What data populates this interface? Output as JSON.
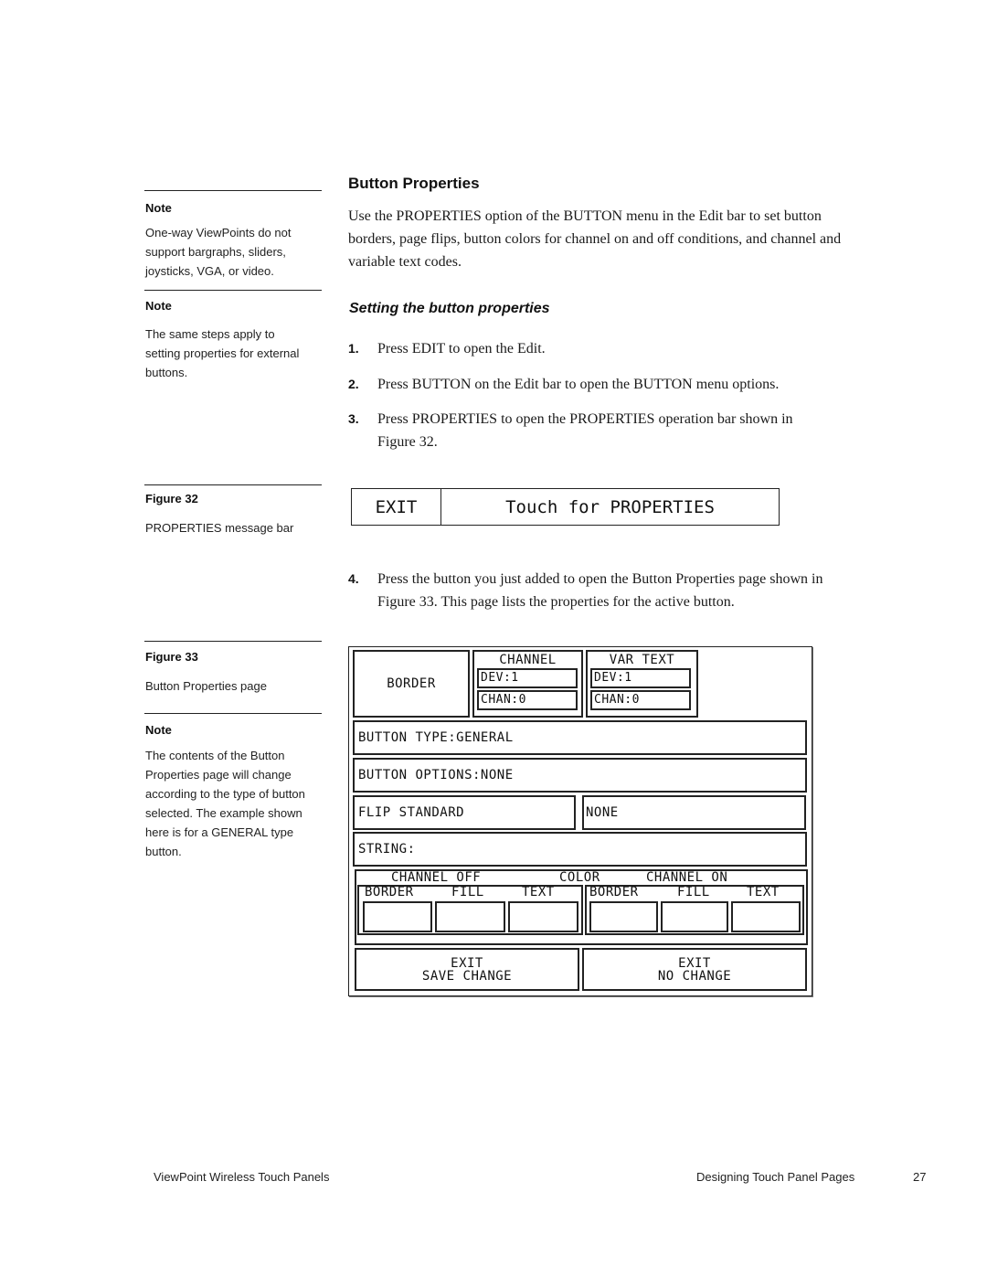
{
  "sidebar": {
    "note1": {
      "heading": "Note",
      "lines": [
        "One-way ViewPoints do not",
        "support bargraphs, sliders,",
        "joysticks, VGA, or video."
      ]
    },
    "note2": {
      "heading": "Note",
      "lines": [
        "The same steps apply to",
        "setting properties for external",
        "buttons."
      ]
    },
    "figure32": {
      "heading": "Figure 32",
      "caption": "PROPERTIES message bar"
    },
    "figure33": {
      "heading": "Figure 33",
      "caption": "Button Properties page"
    },
    "note3": {
      "heading": "Note",
      "lines": [
        "The contents of the Button",
        "Properties page will change",
        "according to the type of button",
        "selected. The example shown",
        "here is for a GENERAL type",
        "button."
      ]
    }
  },
  "main": {
    "section_title": "Button Properties",
    "intro_lines": [
      "Use the PROPERTIES option of the BUTTON menu in the Edit bar to set button",
      "borders, page flips, button colors for channel on and off conditions, and channel and",
      "variable text codes."
    ],
    "subsection_title": "Setting the button properties",
    "steps": [
      {
        "num": "1.",
        "lines": [
          "Press EDIT to open the Edit."
        ]
      },
      {
        "num": "2.",
        "lines": [
          "Press BUTTON on the Edit bar to open the BUTTON menu options."
        ]
      },
      {
        "num": "3.",
        "lines": [
          "Press PROPERTIES to open the PROPERTIES operation bar shown in",
          "Figure 32."
        ]
      },
      {
        "num": "4.",
        "lines": [
          "Press the button you just added to open the Button Properties page shown in",
          "Figure 33. This page lists the properties for the active button."
        ]
      }
    ]
  },
  "figure32_bar": {
    "exit_label": "EXIT",
    "message": "Touch for PROPERTIES"
  },
  "figure33_panel": {
    "border_button": "BORDER",
    "channel": {
      "title": "CHANNEL",
      "dev": "DEV:1",
      "chan": "CHAN:0"
    },
    "var_text": {
      "title": "VAR TEXT",
      "dev": "DEV:1",
      "chan": "CHAN:0"
    },
    "button_type": "BUTTON TYPE:GENERAL",
    "button_options": "BUTTON OPTIONS:NONE",
    "flip": "FLIP STANDARD",
    "flip_target": "NONE",
    "string": "STRING:",
    "color": {
      "channel_off": "CHANNEL OFF",
      "color_label": "COLOR",
      "channel_on": "CHANNEL ON",
      "off_columns": [
        "BORDER",
        "FILL",
        "TEXT"
      ],
      "on_columns": [
        "BORDER",
        "FILL",
        "TEXT"
      ]
    },
    "exit_save": {
      "line1": "EXIT",
      "line2": "SAVE CHANGE"
    },
    "exit_nochange": {
      "line1": "EXIT",
      "line2": "NO CHANGE"
    }
  },
  "footer": {
    "left": "ViewPoint Wireless Touch Panels",
    "right": "Designing Touch Panel Pages",
    "page_number": "27"
  }
}
